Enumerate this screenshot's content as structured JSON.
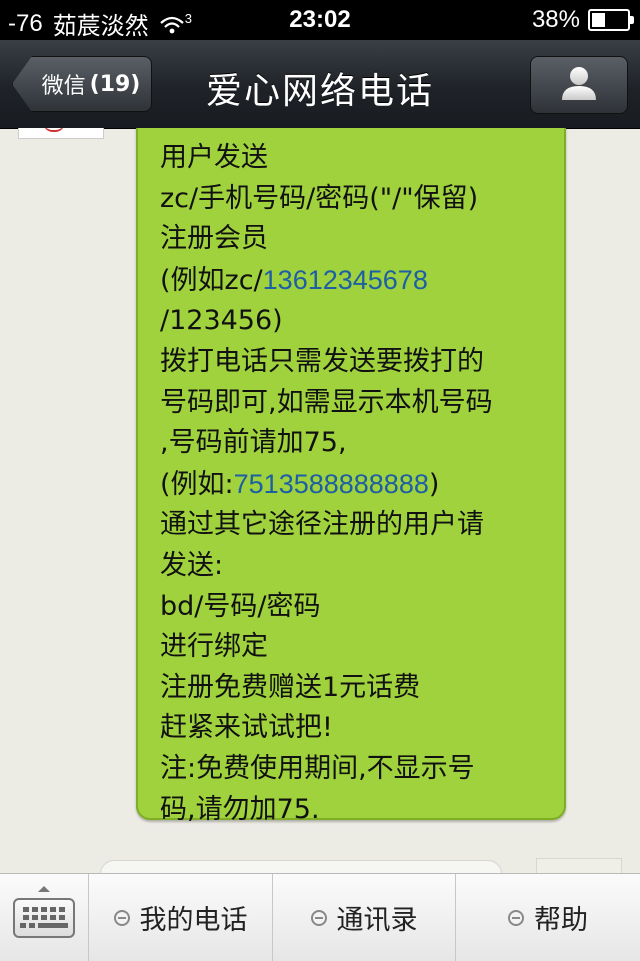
{
  "status_bar": {
    "signal": "-76",
    "carrier": "茹莀淡然",
    "network": "3",
    "time": "23:02",
    "battery_text": "38%",
    "battery_level": 0.38
  },
  "nav": {
    "back_label": "微信",
    "back_count": "(19)",
    "title": "爱心网络电话",
    "profile_icon": "person-icon"
  },
  "message": {
    "lines": [
      [
        {
          "t": "用户发送"
        }
      ],
      [
        {
          "t": "zc/手机号码/密码(\"/\"保留)"
        }
      ],
      [
        {
          "t": "注册会员"
        }
      ],
      [
        {
          "t": "(例如zc/"
        },
        {
          "t": "13612345678",
          "link": true
        }
      ],
      [
        {
          "t": "/123456)"
        }
      ],
      [
        {
          "t": "拨打电话只需发送要拨打的"
        }
      ],
      [
        {
          "t": "号码即可,如需显示本机号码"
        }
      ],
      [
        {
          "t": ",号码前请加75,"
        }
      ],
      [
        {
          "t": "(例如:"
        },
        {
          "t": "7513588888888",
          "link": true
        },
        {
          "t": ")"
        }
      ],
      [
        {
          "t": "通过其它途径注册的用户请"
        }
      ],
      [
        {
          "t": "发送:"
        }
      ],
      [
        {
          "t": "bd/号码/密码"
        }
      ],
      [
        {
          "t": "进行绑定"
        }
      ],
      [
        {
          "t": "注册免费赠送1元话费"
        }
      ],
      [
        {
          "t": "赶紧来试试把!"
        }
      ],
      [
        {
          "t": "注:免费使用期间,不显示号"
        }
      ],
      [
        {
          "t": "码,请勿加75."
        }
      ]
    ]
  },
  "toolbar": {
    "keyboard_icon": "keyboard-icon",
    "menu": [
      {
        "label": "我的电话"
      },
      {
        "label": "通讯录"
      },
      {
        "label": "帮助"
      }
    ]
  },
  "colors": {
    "bubble": "#9fd23c",
    "link": "#1d5fa5",
    "navbar": "#24282d"
  }
}
